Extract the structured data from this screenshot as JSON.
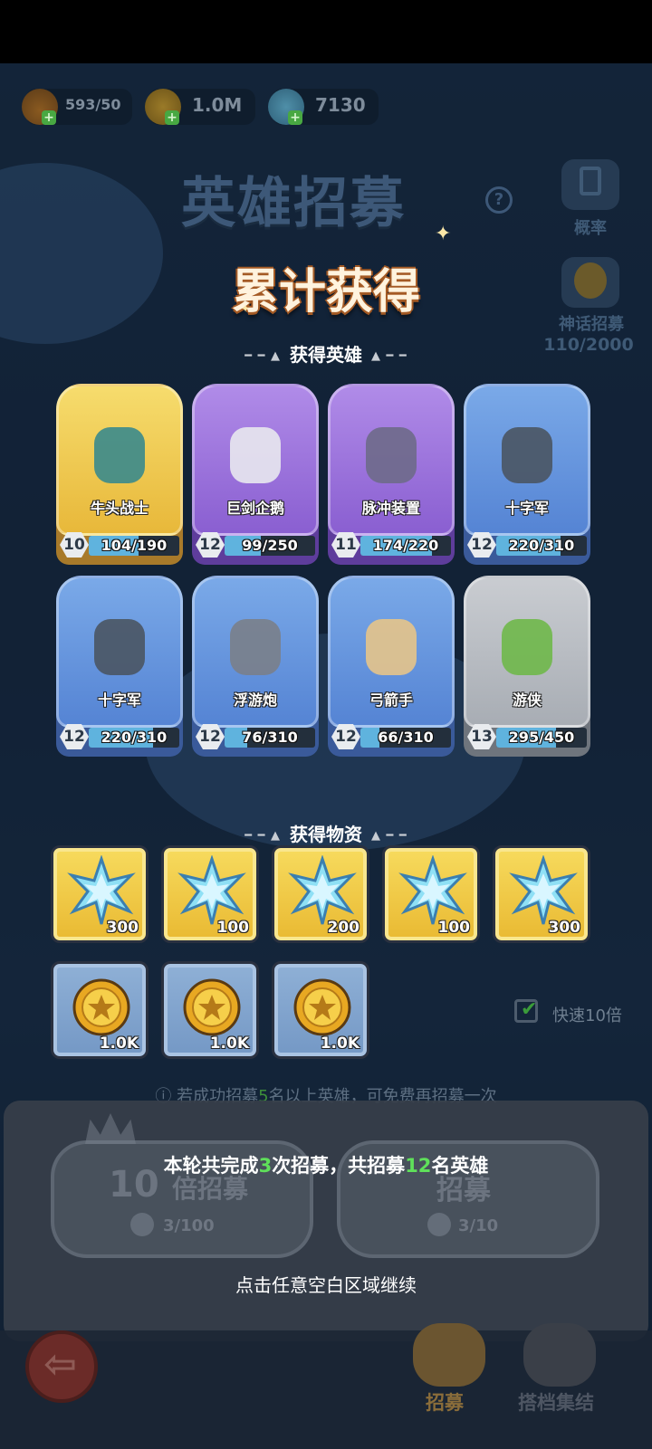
{
  "resources": [
    {
      "icon": "energy-flame-icon",
      "value": "593/50"
    },
    {
      "icon": "gold-coin-icon",
      "value": "1.0M"
    },
    {
      "icon": "ice-crystal-icon",
      "value": "7130"
    }
  ],
  "header": {
    "title": "英雄招募",
    "help": "?"
  },
  "side": {
    "rate_label": "概率",
    "mythic_label": "神话招募",
    "mythic_count": "110/2000"
  },
  "overlay": {
    "title": "累计获得",
    "heroes_section": "获得英雄",
    "items_section": "获得物资",
    "section_deco_left": "━ ━ ▲",
    "section_deco_right": "▲ ━ ━",
    "summary_pre": "本轮共完成",
    "summary_count": "3",
    "summary_mid": "次招募，共招募",
    "summary_heroes": "12",
    "summary_post": "名英雄",
    "continue": "点击任意空白区域继续"
  },
  "heroes": [
    {
      "name": "牛头战士",
      "level": "10",
      "progress": "104/190",
      "rarity": "gold",
      "fill": 0.55,
      "icon": "minotaur-warrior-icon"
    },
    {
      "name": "巨剑企鹅",
      "level": "12",
      "progress": "99/250",
      "rarity": "purple",
      "fill": 0.4,
      "icon": "sword-penguin-icon"
    },
    {
      "name": "脉冲装置",
      "level": "11",
      "progress": "174/220",
      "rarity": "purple",
      "fill": 0.79,
      "icon": "pulse-device-icon"
    },
    {
      "name": "十字军",
      "level": "12",
      "progress": "220/310",
      "rarity": "blue",
      "fill": 0.71,
      "icon": "crusader-knight-icon"
    },
    {
      "name": "十字军",
      "level": "12",
      "progress": "220/310",
      "rarity": "blue",
      "fill": 0.71,
      "icon": "crusader-knight-icon"
    },
    {
      "name": "浮游炮",
      "level": "12",
      "progress": "76/310",
      "rarity": "blue",
      "fill": 0.25,
      "icon": "floating-cannon-icon"
    },
    {
      "name": "弓箭手",
      "level": "12",
      "progress": "66/310",
      "rarity": "blue",
      "fill": 0.21,
      "icon": "archer-icon"
    },
    {
      "name": "游侠",
      "level": "13",
      "progress": "295/450",
      "rarity": "gray",
      "fill": 0.66,
      "icon": "ranger-icon"
    }
  ],
  "items": [
    {
      "icon": "ice-crystal-icon",
      "qty": "300",
      "tier": "gold"
    },
    {
      "icon": "ice-crystal-icon",
      "qty": "100",
      "tier": "gold"
    },
    {
      "icon": "ice-crystal-icon",
      "qty": "200",
      "tier": "gold"
    },
    {
      "icon": "ice-crystal-icon",
      "qty": "100",
      "tier": "gold"
    },
    {
      "icon": "ice-crystal-icon",
      "qty": "300",
      "tier": "gold"
    },
    {
      "icon": "gold-coin-icon",
      "qty": "1.0K",
      "tier": "blue"
    },
    {
      "icon": "gold-coin-icon",
      "qty": "1.0K",
      "tier": "blue"
    },
    {
      "icon": "gold-coin-icon",
      "qty": "1.0K",
      "tier": "blue"
    }
  ],
  "fast": {
    "label": "快速10倍",
    "checked": true
  },
  "hint": {
    "pre": "ⓘ 若成功招募",
    "num": "5",
    "post": "名以上英雄，可免费再招募一次"
  },
  "recruit10": {
    "mult": "10",
    "label": "倍招募",
    "cost": "3/100"
  },
  "recruit1": {
    "label": "招募",
    "cost": "3/10"
  },
  "nav": {
    "recruit": "招募",
    "gather": "搭档集结"
  }
}
